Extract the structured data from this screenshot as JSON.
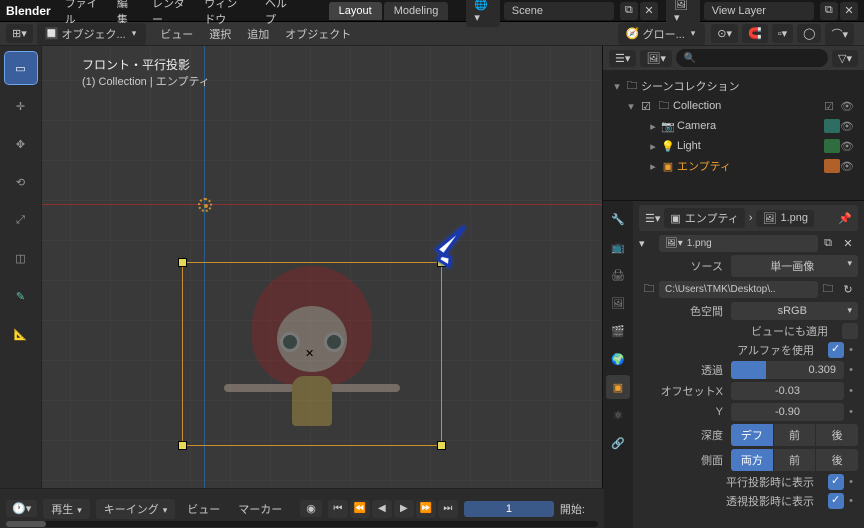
{
  "topbar": {
    "logo": "Blender",
    "menus": [
      "ファイル",
      "編集",
      "レンダー",
      "ウィンドウ",
      "ヘルプ"
    ],
    "tabs": [
      "Layout",
      "Modeling"
    ],
    "active_tab": 0,
    "scene_label": "Scene",
    "viewlayer_label": "View Layer"
  },
  "secondbar": {
    "object_mode": "オブジェク...",
    "menus": [
      "ビュー",
      "選択",
      "追加",
      "オブジェクト"
    ],
    "transform_orient": "グロー..."
  },
  "viewport": {
    "info_line1": "フロント・平行投影",
    "info_line2": "(1) Collection | エンプティ"
  },
  "timeline": {
    "playback": "再生",
    "keying": "キーイング",
    "menus": [
      "ビュー",
      "マーカー"
    ],
    "current_frame": "1",
    "start_label": "開始:"
  },
  "outliner": {
    "root": "シーンコレクション",
    "collection": "Collection",
    "items": [
      {
        "name": "Camera",
        "type": "cam"
      },
      {
        "name": "Light",
        "type": "light"
      },
      {
        "name": "エンプティ",
        "type": "img",
        "selected": true
      }
    ]
  },
  "properties": {
    "header_obj": "エンプティ",
    "header_img": "1.png",
    "browse_img": "1.png",
    "rows": {
      "source_label": "ソース",
      "source_val": "単一画像",
      "path_label": "",
      "path_val": "C:\\Users\\TMK\\Desktop\\..",
      "colorspace_label": "色空間",
      "colorspace_val": "sRGB",
      "apply_view_label": "ビューにも適用",
      "use_alpha_label": "アルファを使用",
      "opacity_label": "透過",
      "opacity_val": "0.309",
      "opacity_fill": "30.9%",
      "offx_label": "オフセットX",
      "offx_val": "-0.03",
      "offy_label": "Y",
      "offy_val": "-0.90",
      "depth_label": "深度",
      "depth_opts": [
        "デフ",
        "前",
        "後"
      ],
      "depth_sel": 0,
      "side_label": "側面",
      "side_opts": [
        "両方",
        "前",
        "後"
      ],
      "side_sel": 0,
      "ortho_label": "平行投影時に表示",
      "persp_label": "透視投影時に表示"
    }
  }
}
